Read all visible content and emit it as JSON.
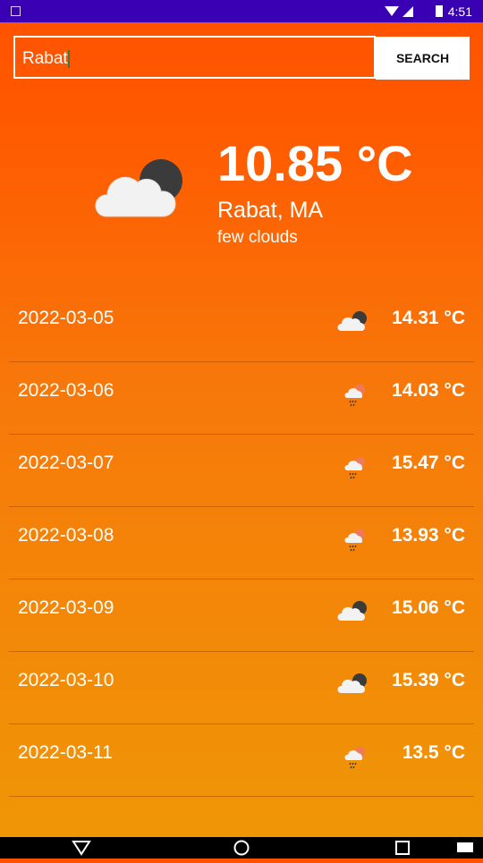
{
  "status_bar": {
    "time": "4:51"
  },
  "search": {
    "value": "Rabat",
    "button_label": "SEARCH"
  },
  "current": {
    "temperature": "10.85 °C",
    "location": "Rabat, MA",
    "description": "few clouds",
    "icon": "cloud-night-icon"
  },
  "forecast": [
    {
      "date": "2022-03-05",
      "temp": "14.31 °C",
      "icon": "cloud-night-icon"
    },
    {
      "date": "2022-03-06",
      "temp": "14.03 °C",
      "icon": "rain-sun-icon"
    },
    {
      "date": "2022-03-07",
      "temp": "15.47 °C",
      "icon": "rain-sun-icon"
    },
    {
      "date": "2022-03-08",
      "temp": "13.93 °C",
      "icon": "rain-sun-icon"
    },
    {
      "date": "2022-03-09",
      "temp": "15.06 °C",
      "icon": "cloud-night-icon"
    },
    {
      "date": "2022-03-10",
      "temp": "15.39 °C",
      "icon": "cloud-night-icon"
    },
    {
      "date": "2022-03-11",
      "temp": "13.5 °C",
      "icon": "rain-sun-icon"
    }
  ]
}
